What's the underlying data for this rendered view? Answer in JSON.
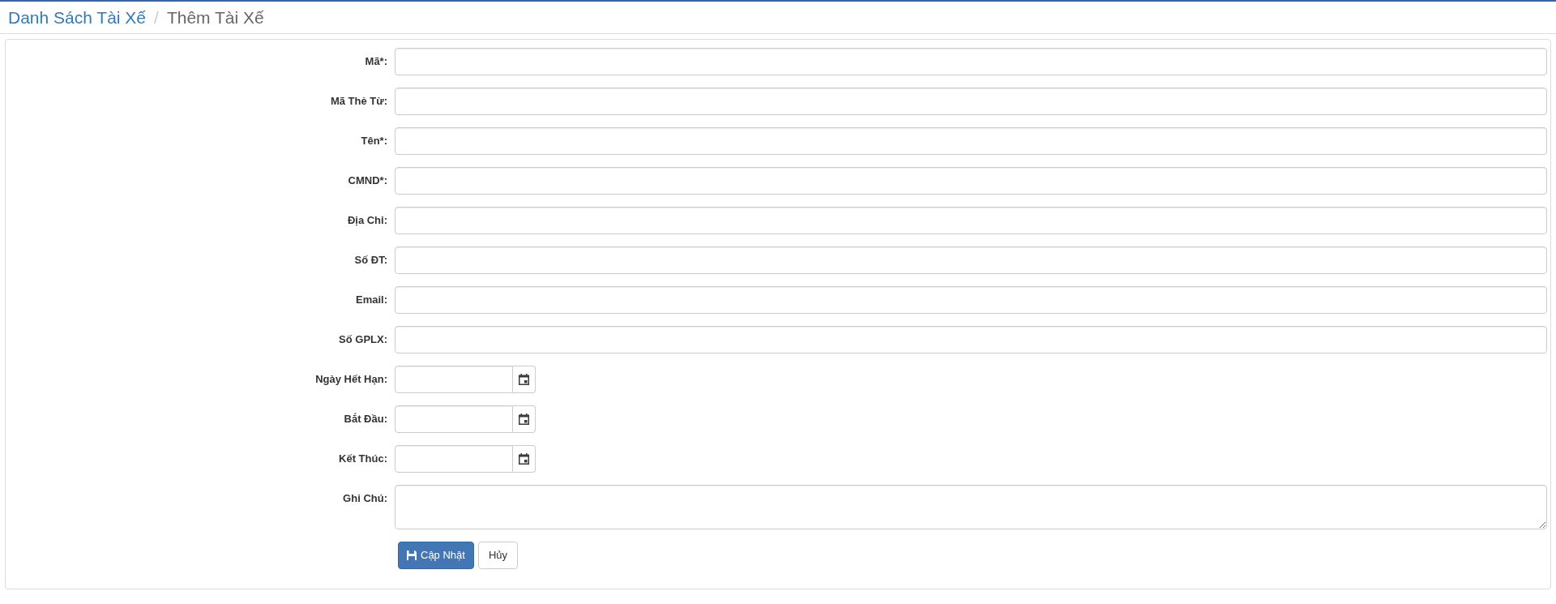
{
  "breadcrumb": {
    "separator": "/",
    "items": [
      {
        "label": "Danh Sách Tài Xế",
        "kind": "link"
      },
      {
        "label": "Thêm Tài Xế",
        "kind": "current"
      }
    ]
  },
  "form": {
    "fields": [
      {
        "label": "Mã*:",
        "kind": "text"
      },
      {
        "label": "Mã Thẻ Từ:",
        "kind": "text"
      },
      {
        "label": "Tên*:",
        "kind": "text"
      },
      {
        "label": "CMND*:",
        "kind": "text"
      },
      {
        "label": "Địa Chỉ:",
        "kind": "text"
      },
      {
        "label": "Số ĐT:",
        "kind": "text"
      },
      {
        "label": "Email:",
        "kind": "text"
      },
      {
        "label": "Số GPLX:",
        "kind": "text"
      },
      {
        "label": "Ngày Hết Hạn:",
        "kind": "date"
      },
      {
        "label": "Bắt Đầu:",
        "kind": "date"
      },
      {
        "label": "Kết Thúc:",
        "kind": "date"
      },
      {
        "label": "Ghi Chú:",
        "kind": "textarea"
      }
    ]
  },
  "buttons": [
    {
      "label": "Cập Nhật",
      "kind": "primary"
    },
    {
      "label": "Hủy",
      "kind": "default"
    }
  ]
}
